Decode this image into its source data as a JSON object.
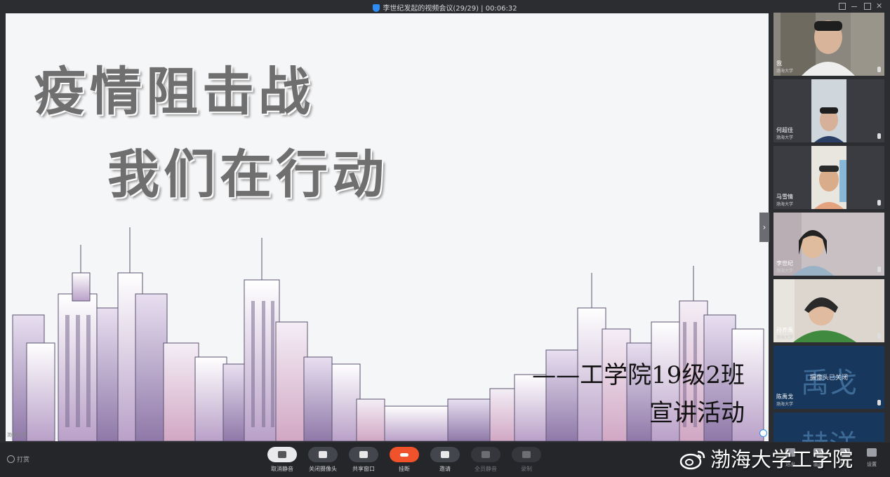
{
  "window": {
    "title": "李世纪发起的视频会议(29/29) | 00:06:32"
  },
  "shared_screen": {
    "headline_line1": "疫情阻击战",
    "headline_line2": "我们在行动",
    "credit_line1": "——工学院19级2班",
    "credit_line2": "宣讲活动",
    "mini_label": "渤海大学"
  },
  "participants": [
    {
      "name": "我",
      "org": "渤海大学",
      "video": "on"
    },
    {
      "name": "何超佳",
      "org": "渤海大学",
      "video": "on"
    },
    {
      "name": "马雪情",
      "org": "渤海大学",
      "video": "on"
    },
    {
      "name": "李世纪",
      "org": "渤海大学",
      "video": "on"
    },
    {
      "name": "孙齐禹",
      "org": "渤海大学",
      "video": "on"
    },
    {
      "name": "陈禹戈",
      "org": "渤海大学",
      "video": "off",
      "avatar_text": "禹戈",
      "camera_off_text": "摄像头已关闭"
    },
    {
      "name": "",
      "org": "",
      "video": "off",
      "avatar_text": "赫洋"
    }
  ],
  "toolbar": {
    "left_label": "打赏",
    "buttons": [
      {
        "label": "取消静音",
        "state": "active"
      },
      {
        "label": "关闭摄像头",
        "state": "normal"
      },
      {
        "label": "共享窗口",
        "state": "normal"
      },
      {
        "label": "挂断",
        "state": "hangup"
      },
      {
        "label": "邀请",
        "state": "normal"
      },
      {
        "label": "全员静音",
        "state": "disabled"
      },
      {
        "label": "录制",
        "state": "disabled"
      }
    ],
    "right_buttons": [
      {
        "label": "退出"
      },
      {
        "label": "画面"
      },
      {
        "label": "列表"
      },
      {
        "label": "设置"
      }
    ]
  },
  "watermark": {
    "text": "渤海大学工学院"
  },
  "colors": {
    "accent": "#2f8cf5",
    "hangup": "#f0522b",
    "background": "#2b2d31"
  }
}
